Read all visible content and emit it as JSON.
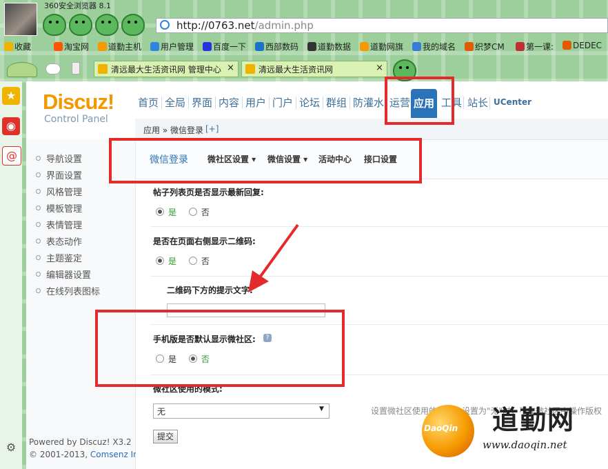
{
  "browser": {
    "title": "360安全浏览器 8.1",
    "address": {
      "host": "http://0763.net",
      "path": "/admin.php"
    },
    "bookmarks": [
      {
        "label": "收藏",
        "icon": "star-icon",
        "color": "#f0b400"
      },
      {
        "label": "淘宝网",
        "icon": "taobao-icon",
        "color": "#ff5500"
      },
      {
        "label": "道勤主机",
        "icon": "daoqin-icon",
        "color": "#f59a00"
      },
      {
        "label": "用户管理",
        "icon": "users-icon",
        "color": "#2e86de"
      },
      {
        "label": "百度一下",
        "icon": "baidu-icon",
        "color": "#2932e1"
      },
      {
        "label": "西部数码",
        "icon": "west-icon",
        "color": "#1a73c8"
      },
      {
        "label": "道勤数据",
        "icon": "data-icon",
        "color": "#333333"
      },
      {
        "label": "道勤网旗",
        "icon": "flag-icon",
        "color": "#f59a00"
      },
      {
        "label": "我的域名",
        "icon": "domain-icon",
        "color": "#3a7bd5"
      },
      {
        "label": "织梦CM",
        "icon": "dede-icon",
        "color": "#e35b00"
      },
      {
        "label": "第一课:",
        "icon": "lesson-icon",
        "color": "#c03030"
      },
      {
        "label": "DEDEC",
        "icon": "dedec-icon",
        "color": "#e35b00"
      }
    ],
    "tabs": [
      {
        "label": "清远最大生活资讯网 管理中心",
        "close": "×"
      },
      {
        "label": "清远最大生活资讯网",
        "close": "×"
      }
    ]
  },
  "panel": {
    "logo": "Discuz!",
    "logo_sub": "Control Panel",
    "nav": [
      "首页",
      "全局",
      "界面",
      "内容",
      "用户",
      "门户",
      "论坛",
      "群组",
      "防灌水",
      "运营",
      "应用",
      "工具",
      "站长",
      "UCenter"
    ],
    "active_nav": "应用",
    "breadcrumb": "应用 » 微信登录",
    "breadcrumb_add": "[+]",
    "sidebar": [
      "导航设置",
      "界面设置",
      "风格管理",
      "模板管理",
      "表情管理",
      "表态动作",
      "主题鉴定",
      "编辑器设置",
      "在线列表图标"
    ],
    "powered": "Powered by Discuz! X3.2",
    "copyright": "© 2001-2013, ",
    "company": "Comsenz Inc."
  },
  "subnav": {
    "active": "微信登录",
    "items": [
      "微社区设置 ▾",
      "微信设置 ▾",
      "活动中心",
      "接口设置"
    ]
  },
  "form": {
    "q1": "帖子列表页是否显示最新回复:",
    "q2": "是否在页面右侧显示二维码:",
    "q3": "二维码下方的提示文字:",
    "q4": "手机版是否默认显示微社区:",
    "q5_partial": "微社区使用的模式:",
    "yes": "是",
    "no": "否",
    "select_value": "无",
    "select_hint": "设置微社区使用的模式，设置为\"无\"时，不在微社区中操作版权",
    "submit": "提交",
    "q1_value": "是",
    "q2_value": "是",
    "q4_value": "否"
  },
  "watermark": {
    "ball_text": "DaoQin",
    "brand": "道勤网",
    "url": "www.daoqin.net"
  },
  "colors": {
    "accent": "#2b73b8",
    "highlight": "#e32b2b",
    "logo": "#f39800"
  }
}
